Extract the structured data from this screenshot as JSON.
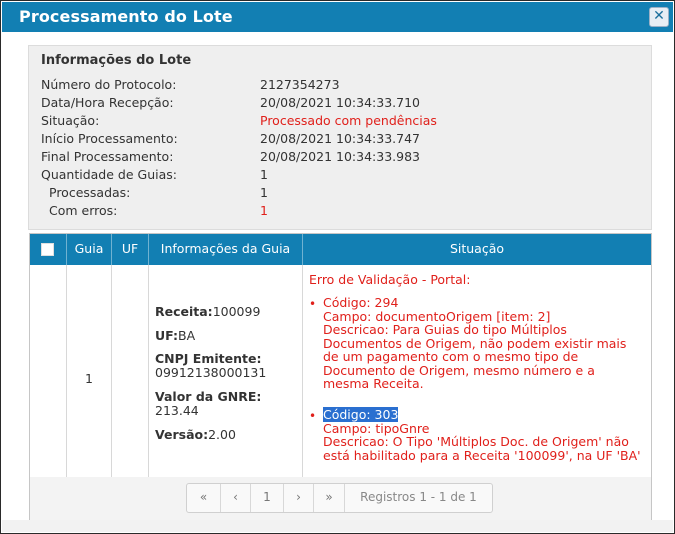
{
  "dialog": {
    "title": "Processamento do Lote",
    "close_label": "✕"
  },
  "info": {
    "heading": "Informações do Lote",
    "fields": [
      {
        "label": "Número do Protocolo:",
        "value": "2127354273"
      },
      {
        "label": "Data/Hora Recepção:",
        "value": "20/08/2021 10:34:33.710"
      },
      {
        "label": "Situação:",
        "value": "Processado com pendências"
      },
      {
        "label": "Início Processamento:",
        "value": "20/08/2021 10:34:33.747"
      },
      {
        "label": "Final Processamento:",
        "value": "20/08/2021 10:34:33.983"
      },
      {
        "label": "Quantidade de Guias:",
        "value": "1"
      },
      {
        "label": "Processadas:",
        "value": "1"
      },
      {
        "label": "Com erros:",
        "value": "1"
      }
    ]
  },
  "table": {
    "headers": {
      "guia": "Guia",
      "uf": "UF",
      "info": "Informações da Guia",
      "situacao": "Situação"
    },
    "row": {
      "guia": "1",
      "receita_label": "Receita:",
      "receita_value": "100099",
      "uf_label": "UF:",
      "uf_value": "BA",
      "cnpj_label": "CNPJ Emitente:",
      "cnpj_value": "09912138000131",
      "valor_label": "Valor da GNRE:",
      "valor_value": "213.44",
      "versao_label": "Versão:",
      "versao_value": "2.00",
      "situacao_title": "Erro de Validação - Portal:",
      "errors": [
        {
          "code": "Código: 294",
          "lines": [
            "Campo: documentoOrigem [item: 2]",
            "Descricao: Para Guias do tipo Múltiplos",
            "Documentos de Origem, não podem existir mais",
            "de um pagamento com o mesmo tipo de",
            "Documento de Origem, mesmo número e a",
            "mesma Receita."
          ]
        },
        {
          "code": "Código: 303",
          "lines": [
            "Campo: tipoGnre",
            "Descricao: O Tipo 'Múltiplos Doc. de Origem' não",
            "está habilitado para a Receita '100099', na UF 'BA'"
          ]
        }
      ]
    }
  },
  "pager": {
    "first": "«",
    "prev": "‹",
    "page": "1",
    "next": "›",
    "last": "»",
    "records": "Registros 1 - 1 de 1"
  },
  "colors": {
    "header": "#127fb3",
    "error": "#e0201b",
    "highlight": "#2a6fd0"
  }
}
